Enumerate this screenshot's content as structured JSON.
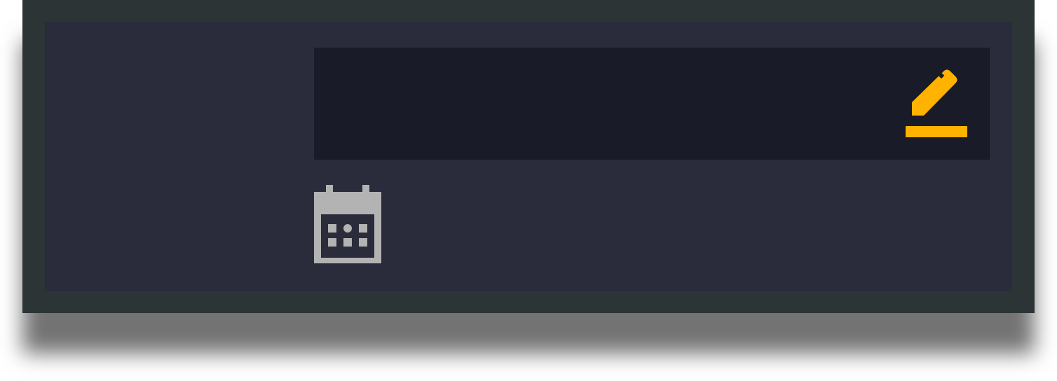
{
  "colors": {
    "window_bg": "#2c3436",
    "panel_bg": "#2a2b3b",
    "input_bg": "#1a1b29",
    "accent": "#ffb300",
    "icon_gray": "#b3b3b3"
  },
  "editor": {
    "value": "",
    "action_icon": "pencil-edit-icon"
  },
  "date": {
    "icon": "calendar-icon",
    "value": ""
  }
}
